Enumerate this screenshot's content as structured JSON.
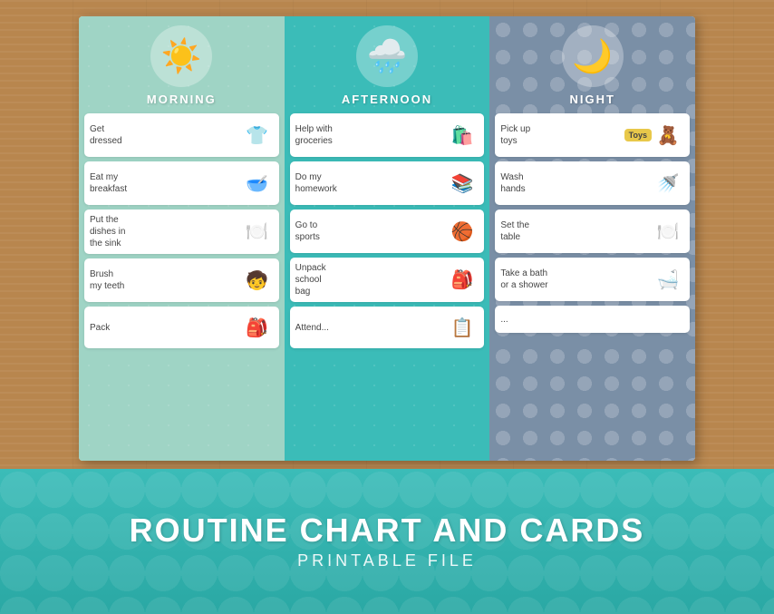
{
  "wood_bg": "#b8864e",
  "paper": {
    "columns": [
      {
        "id": "morning",
        "title": "MORNING",
        "icon": "☀️",
        "bg": "#9fd4c5",
        "tasks": [
          {
            "text": "Get dressed",
            "icon": "👕"
          },
          {
            "text": "Eat my breakfast",
            "icon": "🥣"
          },
          {
            "text": "Put the dishes in the sink",
            "icon": "🍽️"
          },
          {
            "text": "Brush my teeth",
            "icon": "🧒"
          },
          {
            "text": "Pack...",
            "icon": "🎒"
          }
        ]
      },
      {
        "id": "afternoon",
        "title": "AFTERNOON",
        "icon": "🌧️",
        "bg": "#3bbcb8",
        "tasks": [
          {
            "text": "Help with groceries",
            "icon": "🛍️"
          },
          {
            "text": "Do my homework",
            "icon": "📚"
          },
          {
            "text": "Go to sports",
            "icon": "🏀"
          },
          {
            "text": "Unpack school bag",
            "icon": "🎒"
          },
          {
            "text": "Attend...",
            "icon": "📋"
          }
        ]
      },
      {
        "id": "night",
        "title": "NIGHT",
        "icon": "🌙",
        "bg": "#7a8fa6",
        "tasks": [
          {
            "text": "Pick up toys",
            "icon": "🧸",
            "badge": "Toys"
          },
          {
            "text": "Wash hands",
            "icon": "🚿"
          },
          {
            "text": "Set the table",
            "icon": "🍽️"
          },
          {
            "text": "Take a bath or a shower",
            "icon": "🛁"
          },
          {
            "text": "...",
            "icon": ""
          }
        ]
      }
    ]
  },
  "banner": {
    "title": "ROUTINE CHART AND CARDS",
    "subtitle": "PRINTABLE FILE"
  }
}
